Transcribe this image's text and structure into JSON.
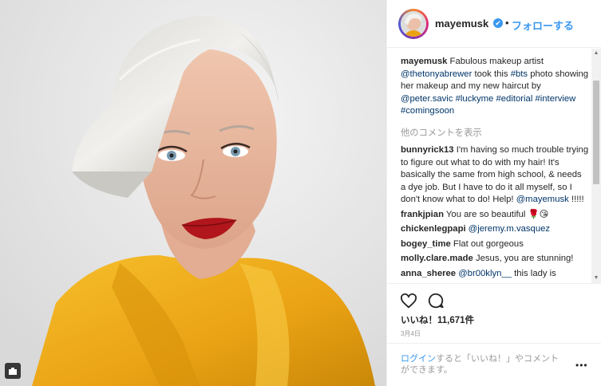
{
  "post": {
    "username": "mayemusk",
    "verified_glyph": "✔",
    "separator": "•",
    "follow_label": "フォローする"
  },
  "caption": {
    "username": "mayemusk",
    "t1": " Fabulous makeup artist ",
    "mention1": "@thetonyabrewer",
    "t2": " took this ",
    "tag1": "#bts",
    "t3": " photo showing her makeup and my new haircut by ",
    "mention2": "@peter.savic",
    "t4": " ",
    "tag2": "#luckyme",
    "t5": " ",
    "tag3": "#editorial",
    "t6": " ",
    "tag4": "#interview",
    "t7": " ",
    "tag5": "#comingsoon"
  },
  "load_more_label": "他のコメントを表示",
  "comments": [
    {
      "user": "bunnyrick13",
      "text": " I'm having so much trouble trying to figure out what to do with my hair! It's basically the same from high school, & needs a dye job. But I have to do it all myself, so I don't know what to do! Help! ",
      "mention": "@mayemusk",
      "after": " !!!!!"
    },
    {
      "user": "frankjpian",
      "text": " You are so beautiful 🌹😘",
      "mention": "",
      "after": ""
    },
    {
      "user": "chickenlegpapi",
      "text": " ",
      "mention": "@jeremy.m.vasquez",
      "after": ""
    },
    {
      "user": "bogey_time",
      "text": " Flat out gorgeous",
      "mention": "",
      "after": ""
    },
    {
      "user": "molly.clare.made",
      "text": " Jesus, you are stunning!",
      "mention": "",
      "after": ""
    },
    {
      "user": "anna_sheree",
      "text": " ",
      "mention": "@br00klyn__",
      "after": " this lady is"
    }
  ],
  "likes_label": "いいね！11,671件",
  "date_label": "3月4日",
  "login": {
    "link": "ログイン",
    "text": "すると「いいね！」やコメントができます。",
    "more_glyph": "•••"
  },
  "colors": {
    "accent": "#3897f0",
    "link": "#003569",
    "muted": "#999999",
    "dress": "#f2b01e"
  },
  "icons": [
    "verified-icon",
    "heart-icon",
    "comment-icon",
    "more-options-icon",
    "photo-badge-icon"
  ]
}
